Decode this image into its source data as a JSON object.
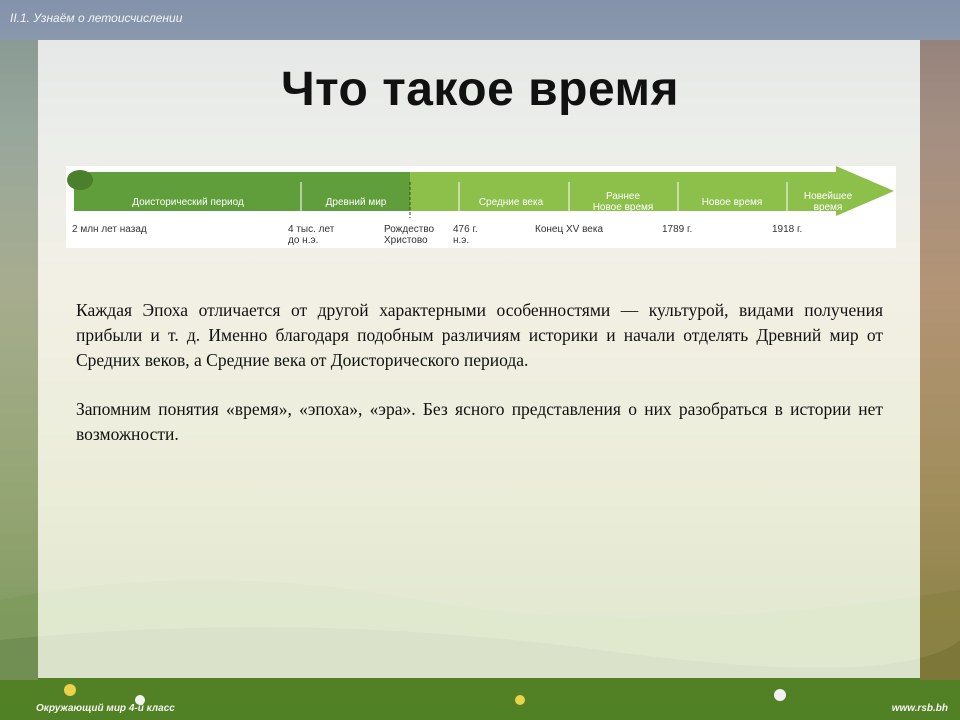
{
  "header": {
    "caption": "II.1. Узнаём о летоисчислении"
  },
  "slide": {
    "title": "Что такое время",
    "paragraphs": [
      "Каждая Эпоха отличается от другой характерными особенностями — культурой, видами получения прибыли и т. д. Именно благодаря подобным различиям историки и начали отделять Древний мир от Средних веков, а Средние века от Доисторического периода.",
      "Запомним понятия «время», «эпоха», «эра». Без ясного представления о них разобраться в истории нет возможности."
    ]
  },
  "timeline": {
    "colors": {
      "dark_green": "#5f9e3a",
      "light_green": "#8cc04a",
      "text_on_bar": "#ffffff",
      "label_text": "#333333"
    },
    "periods": [
      [
        "Доисторический период"
      ],
      [
        "Древний мир"
      ],
      [
        "Средние века"
      ],
      [
        "Раннее",
        "Новое время"
      ],
      [
        "Новое время"
      ],
      [
        "Новейшее",
        "время"
      ]
    ],
    "dates": [
      [
        "2 млн лет назад"
      ],
      [
        "4 тыс. лет",
        "до н.э."
      ],
      [
        "Рождество",
        "Христово"
      ],
      [
        "476 г.",
        "н.э."
      ],
      [
        "Конец XV века"
      ],
      [
        "1789 г."
      ],
      [
        "1918 г."
      ]
    ]
  },
  "footer": {
    "left": "Окружающий мир 4-й класс",
    "right": "www.rsb.bh"
  }
}
